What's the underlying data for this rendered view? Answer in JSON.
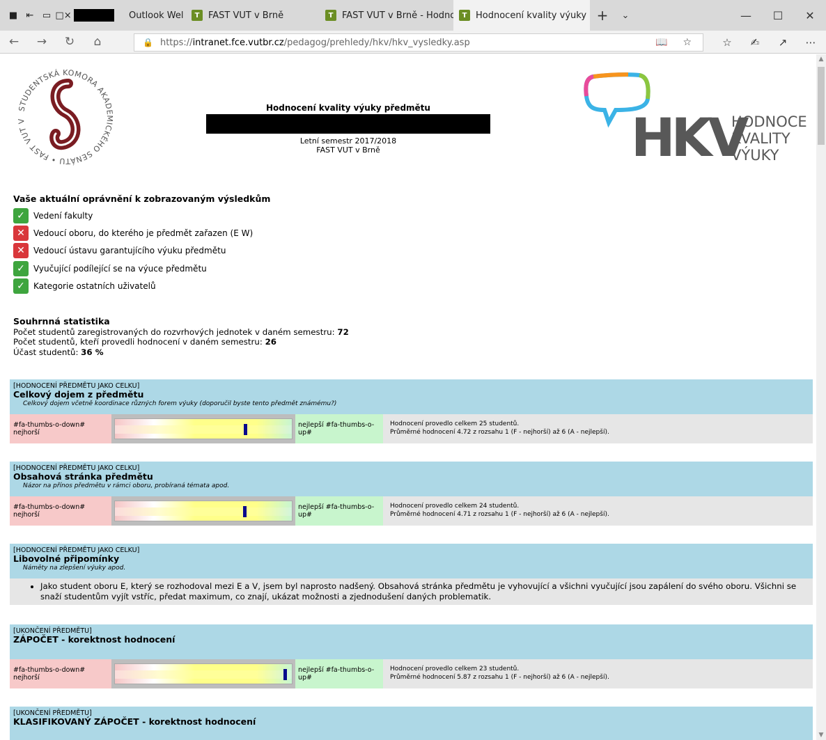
{
  "browser": {
    "tabs": [
      {
        "label": "Outlook Wel"
      },
      {
        "label": "FAST VUT v Brně",
        "favicon": "T"
      },
      {
        "label": "FAST VUT v Brně - Hodnoce",
        "favicon": "T"
      },
      {
        "label": "Hodnocení kvality výuky",
        "favicon": "T",
        "active": true
      }
    ],
    "url_prefix": "https://",
    "url_domain": "intranet.fce.vutbr.cz",
    "url_path": "/pedagog/prehledy/hkv/hkv_vysledky.asp"
  },
  "header": {
    "title": "Hodnocení kvality výuky předmětu",
    "semester": "Letní semestr 2017/2018",
    "faculty": "FAST VUT v Brně",
    "left_logo_text": "STUDENTSKÁ KOMORA AKADEMICKÉHO SENÁTU • FAST VUT V BRNĚ •",
    "right_logo_letters": "HKV",
    "right_logo_lines": [
      "HODNOCENÍ",
      "KVALITY",
      "VÝUKY"
    ]
  },
  "permissions": {
    "heading": "Vaše aktuální oprávnění k zobrazovaným výsledkům",
    "items": [
      {
        "label": "Vedení fakulty",
        "granted": true
      },
      {
        "label": "Vedoucí oboru, do kterého je předmět zařazen (E W)",
        "granted": false
      },
      {
        "label": "Vedoucí ústavu garantujícího výuku předmětu",
        "granted": false
      },
      {
        "label": "Vyučující podílející se na výuce předmětu",
        "granted": true
      },
      {
        "label": "Kategorie ostatních uživatelů",
        "granted": true
      }
    ]
  },
  "stats": {
    "heading": "Souhrnná statistika",
    "registered_label": "Počet studentů zaregistrovaných do rozvrhových jednotek v daném semestru: ",
    "registered_value": "72",
    "rated_label": "Počet studentů, kteří provedli hodnocení v daném semestru: ",
    "rated_value": "26",
    "participation_label": "Účast studentů: ",
    "participation_value": "36 %"
  },
  "sections": [
    {
      "category": "[HODNOCENÍ PŘEDMĚTU JAKO CELKU]",
      "name": "Celkový dojem z předmětu",
      "desc": "Celkový dojem včetně koordinace různých forem výuky (doporučil byste tento předmět známému?)",
      "worst": "#fa-thumbs-o-down# nejhorší",
      "best": "nejlepší #fa-thumbs-o-up#",
      "info1": "Hodnocení provedlo celkem 25 studentů.",
      "info2": "Průměrné hodnocení 4.72 z rozsahu 1 (F - nejhorší) až 6 (A - nejlepší).",
      "average": 4.72
    },
    {
      "category": "[HODNOCENÍ PŘEDMĚTU JAKO CELKU]",
      "name": "Obsahová stránka předmětu",
      "desc": "Názor na přínos předmětu v rámci oboru, probíraná témata apod.",
      "worst": "#fa-thumbs-o-down# nejhorší",
      "best": "nejlepší #fa-thumbs-o-up#",
      "info1": "Hodnocení provedlo celkem 24 studentů.",
      "info2": "Průměrné hodnocení 4.71 z rozsahu 1 (F - nejhorší) až 6 (A - nejlepší).",
      "average": 4.71
    },
    {
      "category": "[HODNOCENÍ PŘEDMĚTU JAKO CELKU]",
      "name": "Libovolné připomínky",
      "desc": "Náměty na zlepšení výuky apod.",
      "comment": "Jako student oboru E, který se rozhodoval mezi E a V, jsem byl naprosto nadšený. Obsahová stránka předmětu je vyhovující a všichni vyučující jsou zapálení do svého oboru. Všichni se snaží studentům vyjít vstříc, předat maximum, co znají, ukázat možnosti a zjednodušení daných problematik."
    },
    {
      "category": "[UKONČENÍ PŘEDMĚTU]",
      "name": "ZÁPOČET - korektnost hodnocení",
      "worst": "#fa-thumbs-o-down# nejhorší",
      "best": "nejlepší #fa-thumbs-o-up#",
      "info1": "Hodnocení provedlo celkem 23 studentů.",
      "info2": "Průměrné hodnocení 5.87 z rozsahu 1 (F - nejhorší) až 6 (A - nejlepší).",
      "average": 5.87
    },
    {
      "category": "[UKONČENÍ PŘEDMĚTU]",
      "name": "KLASIFIKOVANÝ ZÁPOČET - korektnost hodnocení"
    }
  ]
}
